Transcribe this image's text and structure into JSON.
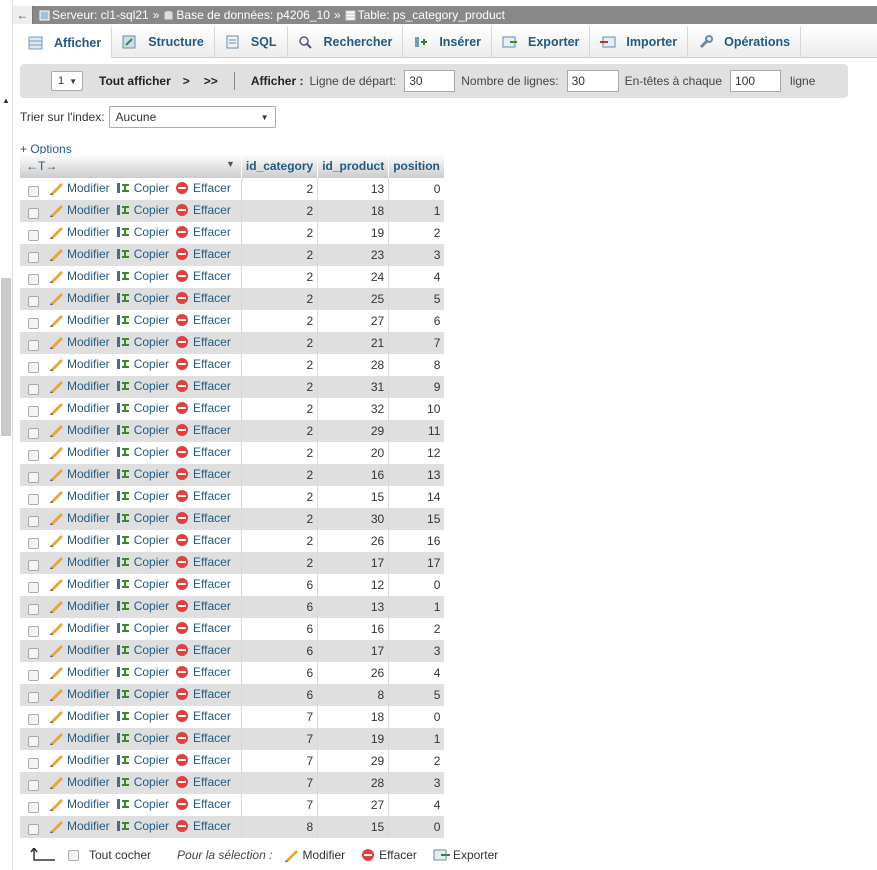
{
  "breadcrumb": {
    "back": "←",
    "server": "Serveur: cl1-sql21",
    "database": "Base de données: p4206_10",
    "table": "Table: ps_category_product",
    "separator": "»"
  },
  "tabs": [
    {
      "label": "Afficher",
      "icon": "browse-icon",
      "active": true
    },
    {
      "label": "Structure",
      "icon": "structure-icon"
    },
    {
      "label": "SQL",
      "icon": "sql-icon"
    },
    {
      "label": "Rechercher",
      "icon": "search-icon"
    },
    {
      "label": "Insérer",
      "icon": "insert-icon"
    },
    {
      "label": "Exporter",
      "icon": "export-icon"
    },
    {
      "label": "Importer",
      "icon": "import-icon"
    },
    {
      "label": "Opérations",
      "icon": "wrench-icon"
    }
  ],
  "nav": {
    "page_select": "1",
    "show_all": "Tout afficher",
    "next": ">",
    "last": ">>",
    "afficher_label": "Afficher :",
    "start_label": "Ligne de départ:",
    "start_value": "30",
    "rows_label": "Nombre de lignes:",
    "rows_value": "30",
    "headers_label": "En-têtes à chaque",
    "headers_value": "100",
    "headers_unit": "ligne"
  },
  "sort": {
    "label": "Trier sur l'index:",
    "value": "Aucune"
  },
  "options_link": "+ Options",
  "table": {
    "arrows": "←T→",
    "columns": [
      "id_category",
      "id_product",
      "position"
    ],
    "actions": {
      "edit": "Modifier",
      "copy": "Copier",
      "delete": "Effacer"
    },
    "rows": [
      [
        2,
        13,
        0
      ],
      [
        2,
        18,
        1
      ],
      [
        2,
        19,
        2
      ],
      [
        2,
        23,
        3
      ],
      [
        2,
        24,
        4
      ],
      [
        2,
        25,
        5
      ],
      [
        2,
        27,
        6
      ],
      [
        2,
        21,
        7
      ],
      [
        2,
        28,
        8
      ],
      [
        2,
        31,
        9
      ],
      [
        2,
        32,
        10
      ],
      [
        2,
        29,
        11
      ],
      [
        2,
        20,
        12
      ],
      [
        2,
        16,
        13
      ],
      [
        2,
        15,
        14
      ],
      [
        2,
        30,
        15
      ],
      [
        2,
        26,
        16
      ],
      [
        2,
        17,
        17
      ],
      [
        6,
        12,
        0
      ],
      [
        6,
        13,
        1
      ],
      [
        6,
        16,
        2
      ],
      [
        6,
        17,
        3
      ],
      [
        6,
        26,
        4
      ],
      [
        6,
        8,
        5
      ],
      [
        7,
        18,
        0
      ],
      [
        7,
        19,
        1
      ],
      [
        7,
        29,
        2
      ],
      [
        7,
        28,
        3
      ],
      [
        7,
        27,
        4
      ],
      [
        8,
        15,
        0
      ]
    ]
  },
  "footer": {
    "check_all": "Tout cocher",
    "with_selected": "Pour la sélection :",
    "edit": "Modifier",
    "delete": "Effacer",
    "export": "Exporter"
  },
  "colors": {
    "link": "#235a81",
    "row_even": "#dfdfdf",
    "breadcrumb_bg": "#888888",
    "delete_icon": "#e04040",
    "edit_icon": "#e8a33a"
  }
}
